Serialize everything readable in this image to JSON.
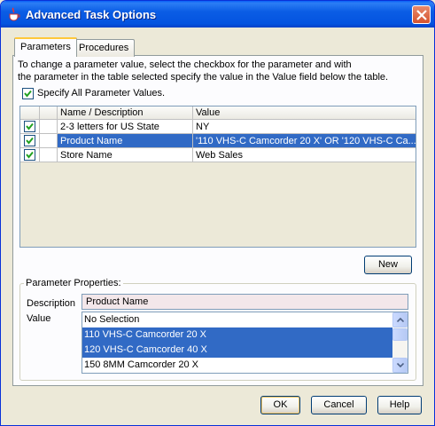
{
  "window": {
    "title": "Advanced Task Options"
  },
  "tabs": [
    {
      "label": "Parameters",
      "active": true
    },
    {
      "label": "Procedures",
      "active": false
    }
  ],
  "instructions": {
    "line1": "To change a parameter value, select the checkbox for the parameter and with",
    "line2": "the parameter in the table selected specify the value in the Value field below the table."
  },
  "specify_all": {
    "label": "Specify All Parameter Values.",
    "checked": true
  },
  "table": {
    "headers": [
      "Name / Description",
      "Value"
    ],
    "rows": [
      {
        "checked": true,
        "name": "2-3 letters for US State",
        "value": "NY",
        "selected": false
      },
      {
        "checked": true,
        "name": "Product Name",
        "value": "'110 VHS-C Camcorder 20 X' OR '120 VHS-C Ca...",
        "selected": true
      },
      {
        "checked": true,
        "name": "Store Name",
        "value": "Web Sales",
        "selected": false
      }
    ]
  },
  "new_button": "New",
  "properties": {
    "legend": "Parameter Properties:",
    "description_label": "Description",
    "description_value": "Product Name",
    "value_label": "Value",
    "options": [
      {
        "label": "No Selection",
        "selected": false
      },
      {
        "label": "110 VHS-C Camcorder 20 X",
        "selected": true
      },
      {
        "label": "120 VHS-C Camcorder 40 X",
        "selected": true
      },
      {
        "label": "150 8MM Camcorder 20 X",
        "selected": false
      }
    ]
  },
  "buttons": {
    "ok": "OK",
    "cancel": "Cancel",
    "help": "Help"
  },
  "colors": {
    "titlebar": "#0454e0",
    "selection": "#316ac5",
    "window_bg": "#ece9d8"
  }
}
